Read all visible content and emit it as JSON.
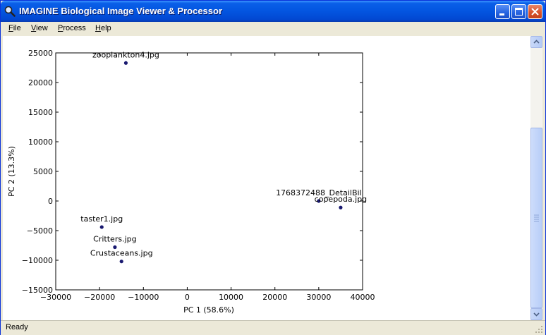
{
  "window": {
    "title": "IMAGINE Biological Image Viewer & Processor",
    "app_icon": "magnifier-icon"
  },
  "menu": {
    "items": [
      {
        "label": "File",
        "accel": "F",
        "rest": "ile"
      },
      {
        "label": "View",
        "accel": "V",
        "rest": "iew"
      },
      {
        "label": "Process",
        "accel": "P",
        "rest": "rocess"
      },
      {
        "label": "Help",
        "accel": "H",
        "rest": "elp"
      }
    ]
  },
  "status": {
    "text": "Ready"
  },
  "colors": {
    "point": "#191970",
    "title_bar": "#0355e0",
    "close": "#d8522c"
  },
  "chart_data": {
    "type": "scatter",
    "xlabel": "PC 1 (58.6%)",
    "ylabel": "PC 2 (13.3%)",
    "xlim": [
      -30000,
      40000
    ],
    "ylim": [
      -15000,
      25000
    ],
    "xticks": [
      -30000,
      -20000,
      -10000,
      0,
      10000,
      20000,
      30000,
      40000
    ],
    "xtick_labels": [
      "−30000",
      "−20000",
      "−10000",
      "0",
      "10000",
      "20000",
      "30000",
      "40000"
    ],
    "yticks": [
      -15000,
      -10000,
      -5000,
      0,
      5000,
      10000,
      15000,
      20000,
      25000
    ],
    "ytick_labels": [
      "−15000",
      "−10000",
      "−5000",
      "0",
      "5000",
      "10000",
      "15000",
      "20000",
      "25000"
    ],
    "grid": false,
    "points": [
      {
        "label": "zooplankton4.jpg",
        "x": -14000,
        "y": 23300
      },
      {
        "label": "taster1.jpg",
        "x": -19500,
        "y": -4400
      },
      {
        "label": "Critters.jpg",
        "x": -16500,
        "y": -7800
      },
      {
        "label": "Crustaceans.jpg",
        "x": -15000,
        "y": -10200
      },
      {
        "label": "1768372488_DetailBil",
        "x": 30000,
        "y": 0
      },
      {
        "label": "copepoda.jpg",
        "x": 35000,
        "y": -1100
      }
    ]
  }
}
